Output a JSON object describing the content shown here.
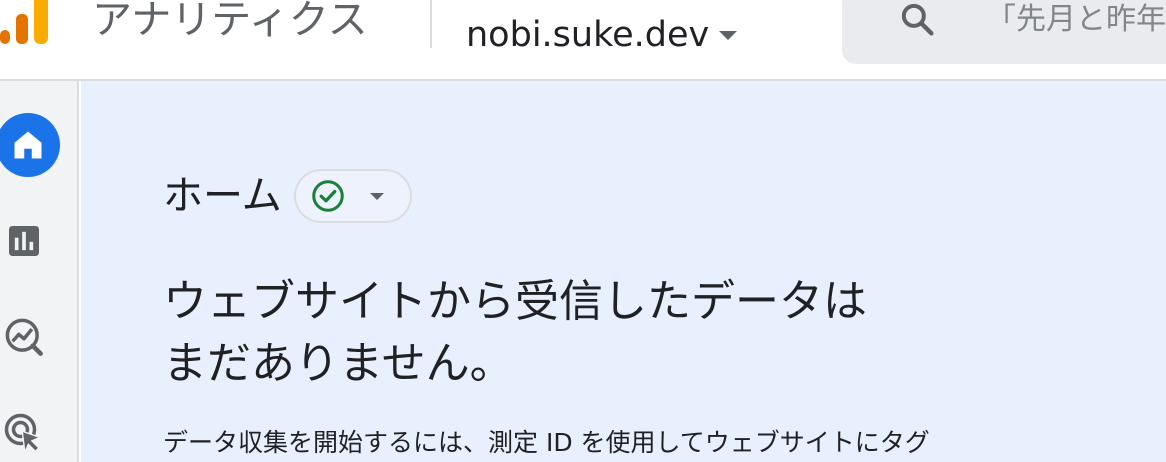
{
  "header": {
    "product_name": "アナリティクス",
    "property_name": "nobi.suke.dev",
    "search_placeholder": "「先月と昨年"
  },
  "nav": {
    "items": [
      {
        "name": "home",
        "icon": "home-icon",
        "active": true
      },
      {
        "name": "reports",
        "icon": "bar-chart-icon",
        "active": false
      },
      {
        "name": "explore",
        "icon": "explore-trend-icon",
        "active": false
      },
      {
        "name": "advertising",
        "icon": "cursor-target-icon",
        "active": false
      }
    ]
  },
  "main": {
    "page_title": "ホーム",
    "headline_line1": "ウェブサイトから受信したデータは",
    "headline_line2": "まだありません。",
    "body_text": "データ収集を開始するには、測定 ID を使用してウェブサイトにタグ"
  },
  "colors": {
    "accent": "#1a73e8",
    "logo_orange": "#e37400",
    "logo_yellow": "#f9ab00",
    "status_green": "#188038",
    "main_background": "#e8f0fe"
  }
}
